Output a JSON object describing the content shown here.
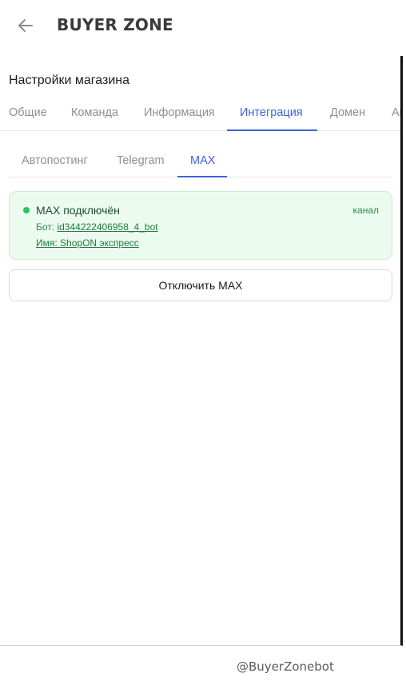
{
  "app": {
    "title": "BUYER ZONE"
  },
  "page": {
    "title": "Настройки магазина"
  },
  "tabs": [
    {
      "label": "Общие",
      "active": false
    },
    {
      "label": "Команда",
      "active": false
    },
    {
      "label": "Информация",
      "active": false
    },
    {
      "label": "Интеграция",
      "active": true
    },
    {
      "label": "Домен",
      "active": false
    },
    {
      "label": "Ак",
      "active": false
    }
  ],
  "subtabs": [
    {
      "label": "Автопостинг",
      "active": false
    },
    {
      "label": "Telegram",
      "active": false
    },
    {
      "label": "MAX",
      "active": true
    }
  ],
  "status": {
    "title": "MAX подключён",
    "channel": "канал",
    "bot_prefix": "Бот: ",
    "bot_name": "id344222406958_4_bot",
    "name_line": "Имя: ShopON экспресс"
  },
  "actions": {
    "disconnect_label": "Отключить MAX"
  },
  "footer": {
    "handle": "@BuyerZonebot"
  },
  "colors": {
    "accent": "#3d63d8",
    "success": "#22c55e",
    "success_bg": "#ebfbef"
  },
  "icons": {
    "back": "arrow-left-icon",
    "status": "status-dot-icon"
  }
}
